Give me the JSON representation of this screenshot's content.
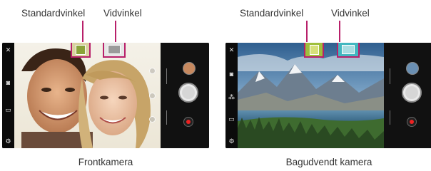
{
  "left": {
    "label_standard": "Standardvinkel",
    "label_wide": "Vidvinkel",
    "caption": "Frontkamera"
  },
  "right": {
    "label_standard": "Standardvinkel",
    "label_wide": "Vidvinkel",
    "caption": "Bagudvendt kamera"
  },
  "colors": {
    "callout_line": "#b8206a",
    "highlight_green": "#9fbf3c",
    "highlight_teal": "#42b7c0",
    "record_red": "#ee2222"
  },
  "icons": [
    "flash-icon",
    "camera-switch-icon",
    "settings-icon",
    "standard-angle-icon",
    "wide-angle-icon",
    "record-icon"
  ]
}
